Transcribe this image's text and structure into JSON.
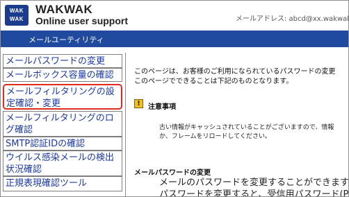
{
  "header": {
    "logo_line1": "WAK",
    "logo_line2": "WAK",
    "brand_name": "WAKWAK",
    "brand_sub": "Online user support",
    "email_display": "メールアドレス: abcd@xx.wakwak.com"
  },
  "titlebar": {
    "title": "メールユーティリティ"
  },
  "sidebar": {
    "items": [
      {
        "label": "メールパスワードの変更"
      },
      {
        "label": "メールボックス容量の確認"
      },
      {
        "label": "メールフィルタリングの設定確認・変更",
        "highlighted": true
      },
      {
        "label": "メールフィルタリングのログ確認"
      },
      {
        "label": "SMTP認証IDの確認"
      },
      {
        "label": "ウイルス感染メールの検出状況確認"
      },
      {
        "label": "正規表現確認ツール"
      }
    ]
  },
  "main": {
    "intro_line1": "このページは、お客様のご利用になられているパスワードの変更",
    "intro_line2": "このページでできることは下記のものとなります。",
    "notice_icon": "!",
    "notice_title": "注意事項",
    "notice_line1": "古い情報がキャッシュされていることがございますので、情報",
    "notice_line2": "か、フレームをリロードしてください。",
    "section_title": "メールパスワードの変更",
    "section_line1": "メールのパスワードを変更することができます",
    "section_line2": "パスワードを変更すると、受信用パスワード(P"
  },
  "colors": {
    "titlebar_bg": "#1f4a9e",
    "link": "#1b39a8",
    "highlight_border": "#e02a1c",
    "notice_icon_bg": "#f4c21b"
  }
}
